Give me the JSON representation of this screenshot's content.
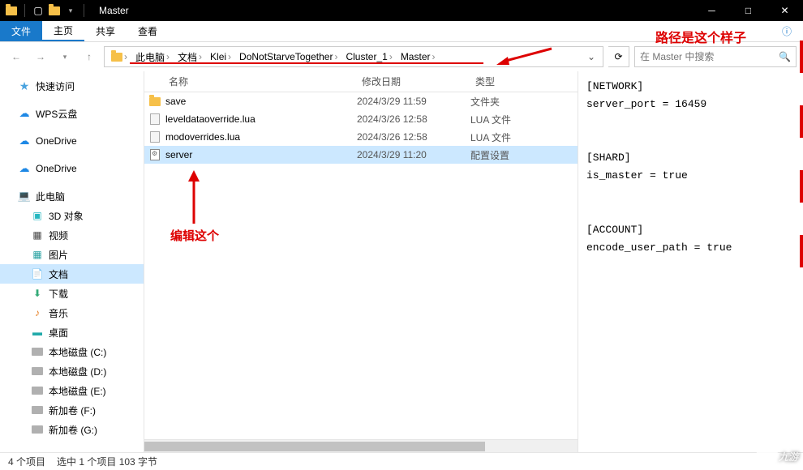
{
  "window": {
    "title": "Master"
  },
  "ribbon": {
    "file": "文件",
    "home": "主页",
    "share": "共享",
    "view": "查看"
  },
  "breadcrumb": {
    "items": [
      "此电脑",
      "文档",
      "Klei",
      "DoNotStarveTogether",
      "Cluster_1",
      "Master"
    ],
    "folder_icon": "folder"
  },
  "search": {
    "placeholder": "在 Master 中搜索"
  },
  "columns": {
    "name": "名称",
    "date": "修改日期",
    "type": "类型"
  },
  "files": [
    {
      "icon": "folder",
      "name": "save",
      "date": "2024/3/29 11:59",
      "type": "文件夹",
      "selected": false
    },
    {
      "icon": "lua",
      "name": "leveldataoverride.lua",
      "date": "2024/3/26 12:58",
      "type": "LUA 文件",
      "selected": false
    },
    {
      "icon": "lua",
      "name": "modoverrides.lua",
      "date": "2024/3/26 12:58",
      "type": "LUA 文件",
      "selected": false
    },
    {
      "icon": "ini",
      "name": "server",
      "date": "2024/3/29 11:20",
      "type": "配置设置",
      "selected": true
    }
  ],
  "sidebar": {
    "quick": "快速访问",
    "wps": "WPS云盘",
    "onedrive1": "OneDrive",
    "onedrive2": "OneDrive",
    "thispc": "此电脑",
    "pc_children": [
      "3D 对象",
      "视频",
      "图片",
      "文档",
      "下载",
      "音乐",
      "桌面",
      "本地磁盘 (C:)",
      "本地磁盘 (D:)",
      "本地磁盘 (E:)",
      "新加卷 (F:)",
      "新加卷 (G:)"
    ]
  },
  "preview": "[NETWORK]\nserver_port = 16459\n\n\n[SHARD]\nis_master = true\n\n\n[ACCOUNT]\nencode_user_path = true",
  "status": {
    "count": "4 个项目",
    "selection": "选中 1 个项目  103 字节"
  },
  "annotations": {
    "path_label": "路径是这个样子",
    "edit_label": "编辑这个"
  },
  "watermark": "九游"
}
